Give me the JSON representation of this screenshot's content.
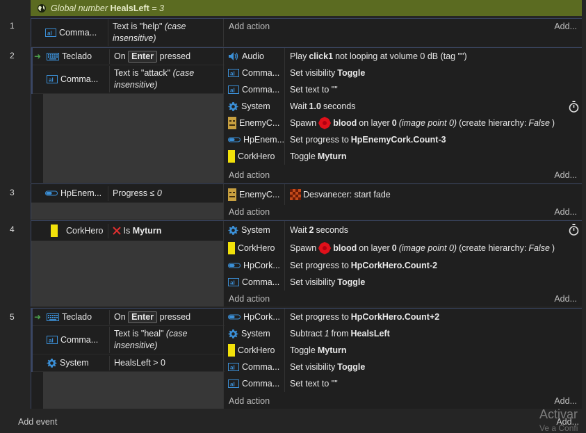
{
  "global_bar": {
    "label": "Global number",
    "name": "HealsLeft",
    "value": "= 3"
  },
  "common": {
    "add_action": "Add action",
    "add_condition": "Add...",
    "add": "Add..."
  },
  "events": [
    {
      "num": "1",
      "conditions": [
        {
          "obj": "Comma...",
          "pre": "Text is \"help\" ",
          "em": "(case insensitive)"
        }
      ]
    },
    {
      "num": "2",
      "conditions": [
        {
          "obj": "Teclado",
          "pre": "On",
          "key": "Enter",
          "post": "pressed"
        },
        {
          "obj": "Comma...",
          "pre": "Text is \"attack\" ",
          "em": "(case insensitive)"
        }
      ],
      "actions": [
        {
          "obj": "Audio",
          "t1": "Play",
          "b1": "click1",
          "t2": "not looping at volume 0 dB (tag \"\")"
        },
        {
          "obj": "Comma...",
          "t1": "Set visibility",
          "b1": "Toggle"
        },
        {
          "obj": "Comma...",
          "t1": "Set text to \"\""
        },
        {
          "obj": "System",
          "t1": "Wait",
          "b1": "1.0",
          "t2": "seconds"
        },
        {
          "obj": "EnemyC...",
          "t1": "Spawn",
          "b1": "blood",
          "t2": "on layer",
          "b2": "0",
          "e1": "(image point 0)",
          "t3": "(create hierarchy:",
          "e2": "False",
          "t4": ")"
        },
        {
          "obj": "HpEnem...",
          "t1": "Set progress to",
          "b1": "HpEnemyCork.Count-3"
        },
        {
          "obj": "CorkHero",
          "t1": "Toggle",
          "b1": "Myturn"
        }
      ]
    },
    {
      "num": "3",
      "conditions": [
        {
          "obj": "HpEnem...",
          "pre": "Progress ≤ ",
          "em": "0"
        }
      ],
      "actions": [
        {
          "obj": "EnemyC...",
          "t1": "Desvanecer: start fade"
        }
      ]
    },
    {
      "num": "4",
      "conditions": [
        {
          "obj": "CorkHero",
          "pre": "Is",
          "b": "Myturn"
        }
      ],
      "actions": [
        {
          "obj": "System",
          "t1": "Wait",
          "b1": "2",
          "t2": "seconds"
        },
        {
          "obj": "CorkHero",
          "t1": "Spawn",
          "b1": "blood",
          "t2": "on layer",
          "b2": "0",
          "e1": "(image point 0)",
          "t3": "(create hierarchy:",
          "e2": "False",
          "t4": ")"
        },
        {
          "obj": "HpCork...",
          "t1": "Set progress to",
          "b1": "HpCorkHero.Count-2"
        },
        {
          "obj": "Comma...",
          "t1": "Set visibility",
          "b1": "Toggle"
        }
      ]
    },
    {
      "num": "5",
      "conditions": [
        {
          "obj": "Teclado",
          "pre": "On",
          "key": "Enter",
          "post": "pressed"
        },
        {
          "obj": "Comma...",
          "pre": "Text is \"heal\" ",
          "em": "(case insensitive)"
        },
        {
          "obj": "System",
          "pre": "HealsLeft > 0"
        }
      ],
      "actions": [
        {
          "obj": "HpCork...",
          "t1": "Set progress to",
          "b1": "HpCorkHero.Count+2"
        },
        {
          "obj": "System",
          "t1": "Subtract",
          "e1": "1",
          "t2": "from",
          "b1": "HealsLeft"
        },
        {
          "obj": "CorkHero",
          "t1": "Toggle",
          "b1": "Myturn"
        },
        {
          "obj": "Comma...",
          "t1": "Set visibility",
          "b1": "Toggle"
        },
        {
          "obj": "Comma...",
          "t1": "Set text to \"\""
        }
      ]
    }
  ],
  "footer": {
    "add_event": "Add event",
    "add": "Add..."
  },
  "watermark": {
    "line1": "Activar",
    "line2": "Ve a Confi"
  },
  "colors": {
    "global_bar": "#5b6b21",
    "event_border": "#3a4663",
    "condition_bg": "#1f1f1f",
    "side_fill": "#373737"
  }
}
